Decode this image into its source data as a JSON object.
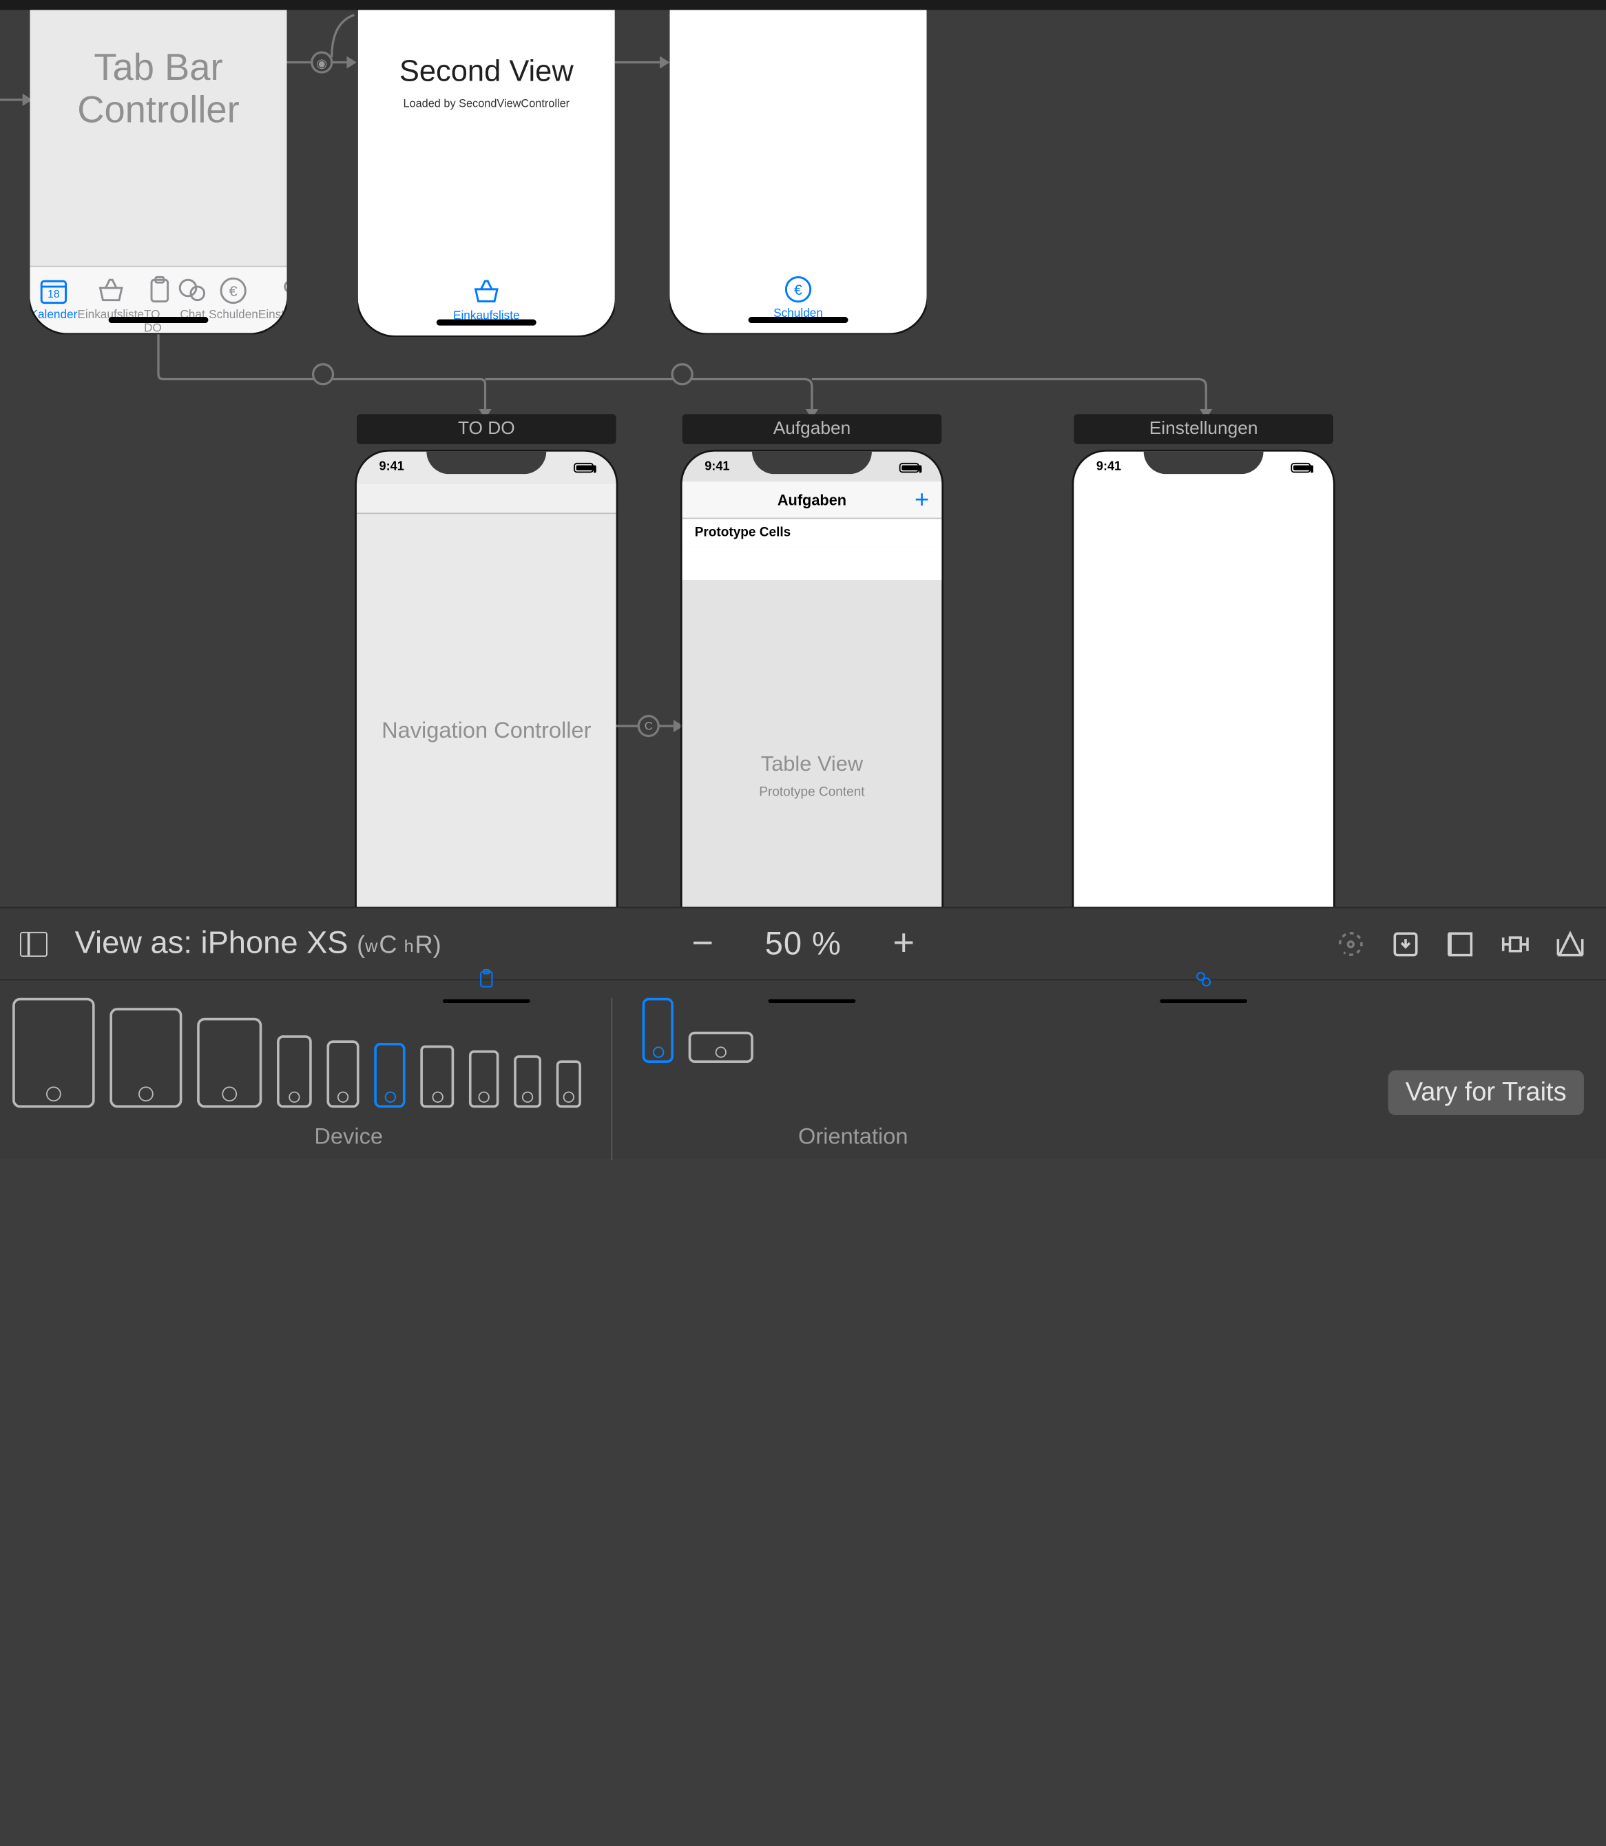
{
  "scenes": {
    "tabbar_controller": {
      "title": "Tab Bar Controller"
    },
    "second_view": {
      "title": "Second View",
      "subtitle": "Loaded by SecondViewController"
    },
    "nav_controller": {
      "scene_title": "TO DO",
      "title": "Navigation Controller"
    },
    "table_view": {
      "scene_title": "Aufgaben",
      "nav_title": "Aufgaben",
      "add_btn": "+",
      "proto_header": "Prototype Cells",
      "title": "Table View",
      "subtitle": "Prototype Content"
    },
    "settings": {
      "scene_title": "Einstellungen"
    }
  },
  "status_time": "9:41",
  "tabs": {
    "kalender": "Kalender",
    "einkaufsliste": "Einkaufsliste",
    "todo": "TO DO",
    "chat": "Chat",
    "schulden": "Schulden",
    "einstellungen": "Einstellungen"
  },
  "device_bar": {
    "view_as_prefix": "View as: ",
    "device_name": "iPhone XS",
    "size_class_w": "w",
    "size_class_C": "C",
    "size_class_h": "h",
    "size_class_R": "R",
    "zoom": "50 %",
    "device_caption": "Device",
    "orientation_caption": "Orientation",
    "vary": "Vary for Traits"
  }
}
